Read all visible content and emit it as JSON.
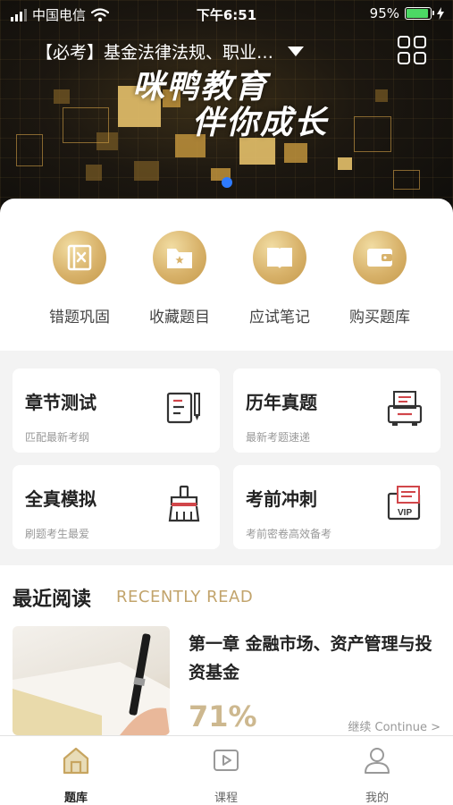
{
  "status_bar": {
    "carrier": "中国电信",
    "time": "下午6:51",
    "battery": "95%"
  },
  "header": {
    "subject": "【必考】基金法律法规、职业…",
    "slogan_line1": "咪鸭教育",
    "slogan_line2": "伴你成长"
  },
  "quick_actions": [
    {
      "label": "错题巩固",
      "icon": "wrong-questions-icon"
    },
    {
      "label": "收藏题目",
      "icon": "favorites-folder-icon"
    },
    {
      "label": "应试笔记",
      "icon": "notebook-icon"
    },
    {
      "label": "购买题库",
      "icon": "wallet-icon"
    }
  ],
  "features": [
    {
      "title": "章节测试",
      "subtitle": "匹配最新考纲",
      "icon": "chapter-test-icon"
    },
    {
      "title": "历年真题",
      "subtitle": "最新考题速递",
      "icon": "past-papers-icon"
    },
    {
      "title": "全真模拟",
      "subtitle": "刷题考生最爱",
      "icon": "mock-exam-brush-icon"
    },
    {
      "title": "考前冲刺",
      "subtitle": "考前密卷高效备考",
      "icon": "vip-sprint-icon"
    }
  ],
  "recent": {
    "heading_cn": "最近阅读",
    "heading_en": "RECENTLY READ",
    "item_title": "第一章 金融市场、资产管理与投资基金",
    "progress_label": "71%",
    "progress": 0.71,
    "continue_label": "继续 Continue >"
  },
  "tabs": [
    {
      "label": "题库",
      "icon": "home-icon",
      "active": true
    },
    {
      "label": "课程",
      "icon": "course-play-icon",
      "active": false
    },
    {
      "label": "我的",
      "icon": "profile-icon",
      "active": false
    }
  ],
  "colors": {
    "accent_gold": "#d8b26a",
    "progress_gold": "#cdb88f",
    "banner_dark": "#1c1710"
  }
}
